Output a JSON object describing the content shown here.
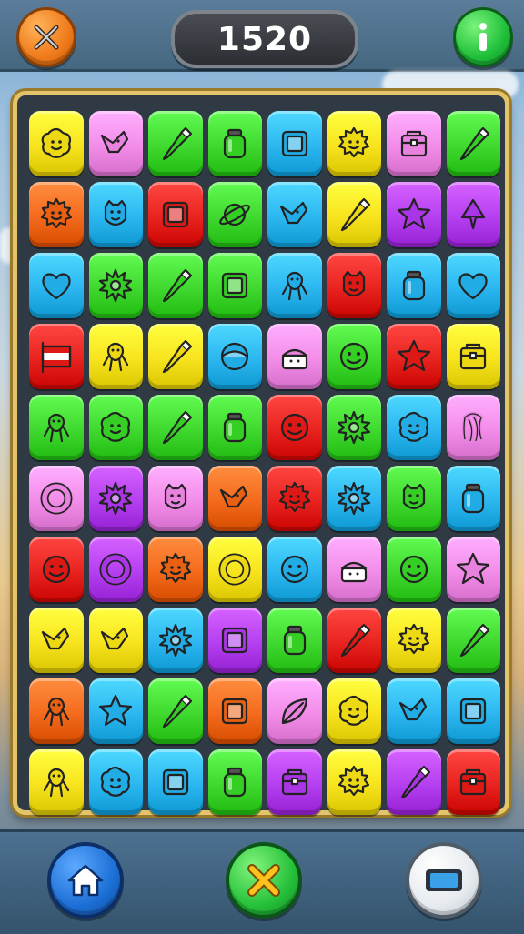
{
  "hud": {
    "score": "1520",
    "pause_icon": "crossed-swords-icon",
    "info_icon": "info-icon"
  },
  "footer": {
    "home_icon": "home-icon",
    "close_icon": "close-x-icon",
    "screen_icon": "screen-icon"
  },
  "colors": {
    "yellow": "#f7e31d",
    "pink": "#f28ce8",
    "green": "#3fd82f",
    "blue": "#2bb6f0",
    "orange": "#f46a1c",
    "red": "#e8231f",
    "purple": "#b43ff0",
    "lime": "#45d43a"
  },
  "board": {
    "rows": [
      [
        {
          "c": "yellow",
          "i": "blob"
        },
        {
          "c": "pink",
          "i": "bird"
        },
        {
          "c": "green",
          "i": "crayon"
        },
        {
          "c": "green",
          "i": "jar"
        },
        {
          "c": "blue",
          "i": "box"
        },
        {
          "c": "yellow",
          "i": "sun-face"
        },
        {
          "c": "pink",
          "i": "chest"
        },
        {
          "c": "green",
          "i": "crayon"
        }
      ],
      [
        {
          "c": "orange",
          "i": "sun-face"
        },
        {
          "c": "blue",
          "i": "face"
        },
        {
          "c": "red",
          "i": "box"
        },
        {
          "c": "green",
          "i": "planet"
        },
        {
          "c": "blue",
          "i": "bird"
        },
        {
          "c": "yellow",
          "i": "crayon"
        },
        {
          "c": "purple",
          "i": "star"
        },
        {
          "c": "purple",
          "i": "cone"
        }
      ],
      [
        {
          "c": "blue",
          "i": "heart"
        },
        {
          "c": "green",
          "i": "flower"
        },
        {
          "c": "green",
          "i": "crayon"
        },
        {
          "c": "green",
          "i": "box"
        },
        {
          "c": "blue",
          "i": "creature"
        },
        {
          "c": "red",
          "i": "face"
        },
        {
          "c": "blue",
          "i": "jar"
        },
        {
          "c": "blue",
          "i": "heart"
        }
      ],
      [
        {
          "c": "red",
          "i": "flag"
        },
        {
          "c": "yellow",
          "i": "creature"
        },
        {
          "c": "yellow",
          "i": "crayon"
        },
        {
          "c": "blue",
          "i": "ball"
        },
        {
          "c": "pink",
          "i": "cake"
        },
        {
          "c": "green",
          "i": "smiley"
        },
        {
          "c": "red",
          "i": "star"
        },
        {
          "c": "yellow",
          "i": "chest"
        }
      ],
      [
        {
          "c": "green",
          "i": "creature"
        },
        {
          "c": "green",
          "i": "blob"
        },
        {
          "c": "green",
          "i": "crayon"
        },
        {
          "c": "green",
          "i": "jar"
        },
        {
          "c": "red",
          "i": "smiley"
        },
        {
          "c": "green",
          "i": "flower"
        },
        {
          "c": "blue",
          "i": "blob"
        },
        {
          "c": "pink",
          "i": "squid"
        }
      ],
      [
        {
          "c": "pink",
          "i": "ring"
        },
        {
          "c": "purple",
          "i": "flower"
        },
        {
          "c": "pink",
          "i": "face"
        },
        {
          "c": "orange",
          "i": "bird"
        },
        {
          "c": "red",
          "i": "sun-face"
        },
        {
          "c": "blue",
          "i": "flower"
        },
        {
          "c": "green",
          "i": "face"
        },
        {
          "c": "blue",
          "i": "jar"
        }
      ],
      [
        {
          "c": "red",
          "i": "smiley"
        },
        {
          "c": "purple",
          "i": "ring"
        },
        {
          "c": "orange",
          "i": "sun-face"
        },
        {
          "c": "yellow",
          "i": "ring"
        },
        {
          "c": "blue",
          "i": "smiley"
        },
        {
          "c": "pink",
          "i": "cake"
        },
        {
          "c": "green",
          "i": "smiley"
        },
        {
          "c": "pink",
          "i": "star"
        }
      ],
      [
        {
          "c": "yellow",
          "i": "bird"
        },
        {
          "c": "yellow",
          "i": "bird"
        },
        {
          "c": "blue",
          "i": "flower"
        },
        {
          "c": "purple",
          "i": "box"
        },
        {
          "c": "green",
          "i": "jar"
        },
        {
          "c": "red",
          "i": "crayon"
        },
        {
          "c": "yellow",
          "i": "sun-face"
        },
        {
          "c": "green",
          "i": "crayon"
        }
      ],
      [
        {
          "c": "orange",
          "i": "creature"
        },
        {
          "c": "blue",
          "i": "star"
        },
        {
          "c": "green",
          "i": "crayon"
        },
        {
          "c": "orange",
          "i": "box"
        },
        {
          "c": "pink",
          "i": "leaf"
        },
        {
          "c": "yellow",
          "i": "blob"
        },
        {
          "c": "blue",
          "i": "bird"
        },
        {
          "c": "blue",
          "i": "box"
        }
      ],
      [
        {
          "c": "yellow",
          "i": "creature"
        },
        {
          "c": "blue",
          "i": "blob"
        },
        {
          "c": "blue",
          "i": "box"
        },
        {
          "c": "green",
          "i": "jar"
        },
        {
          "c": "purple",
          "i": "chest"
        },
        {
          "c": "yellow",
          "i": "sun-face"
        },
        {
          "c": "purple",
          "i": "crayon"
        },
        {
          "c": "red",
          "i": "chest"
        }
      ]
    ]
  }
}
